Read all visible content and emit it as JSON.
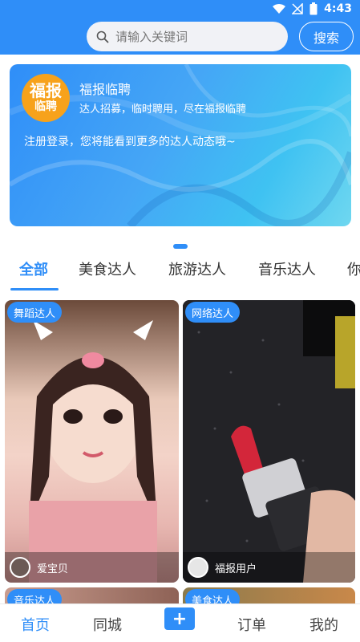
{
  "status_bar": {
    "time": "4:43"
  },
  "search": {
    "placeholder": "请输入关键词",
    "button_label": "搜索"
  },
  "banner": {
    "logo_top": "福报",
    "logo_bottom": "临聘",
    "title": "福报临聘",
    "subtitle": "达人招募，临时聘用，尽在福报临聘",
    "description": "注册登录，您将能看到更多的达人动态哦~"
  },
  "tabs": [
    {
      "label": "全部"
    },
    {
      "label": "美食达人"
    },
    {
      "label": "旅游达人"
    },
    {
      "label": "音乐达人"
    },
    {
      "label": "你"
    }
  ],
  "cards": [
    {
      "tag": "舞蹈达人",
      "user": "爱宝贝"
    },
    {
      "tag": "网络达人",
      "user": "福报用户"
    },
    {
      "tag": "音乐达人"
    },
    {
      "tag": "美食达人"
    }
  ],
  "bottom_nav": {
    "home": "首页",
    "local": "同城",
    "add": "+",
    "orders": "订单",
    "mine": "我的"
  },
  "colors": {
    "accent": "#2f8ef8",
    "logo": "#f7a21b"
  }
}
